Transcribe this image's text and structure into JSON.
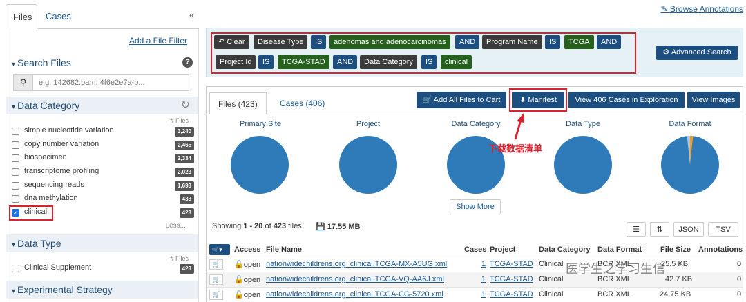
{
  "sidebar": {
    "tabs": [
      {
        "label": "Files"
      },
      {
        "label": "Cases"
      }
    ],
    "collapse_icon": "double-chevron-left-icon",
    "add_filter": "Add a File Filter",
    "search_files": {
      "title": "Search Files",
      "placeholder": "e.g. 142682.bam, 4f6e2e7a-b..."
    },
    "data_category": {
      "title": "Data Category",
      "col_label": "# Files",
      "items": [
        {
          "label": "simple nucleotide variation",
          "count": "3,240",
          "checked": false
        },
        {
          "label": "copy number variation",
          "count": "2,465",
          "checked": false
        },
        {
          "label": "biospecimen",
          "count": "2,334",
          "checked": false
        },
        {
          "label": "transcriptome profiling",
          "count": "2,023",
          "checked": false
        },
        {
          "label": "sequencing reads",
          "count": "1,693",
          "checked": false
        },
        {
          "label": "dna methylation",
          "count": "433",
          "checked": false
        },
        {
          "label": "clinical",
          "count": "423",
          "checked": true
        }
      ],
      "less": "Less..."
    },
    "data_type": {
      "title": "Data Type",
      "col_label": "# Files",
      "items": [
        {
          "label": "Clinical Supplement",
          "count": "423",
          "checked": false
        }
      ]
    },
    "experimental_strategy": {
      "title": "Experimental Strategy"
    }
  },
  "header": {
    "browse_annotations": "Browse Annotations"
  },
  "query": {
    "clear": "Clear",
    "chips_row1": [
      "Disease Type",
      "IS",
      "adenomas and adenocarcinomas",
      "AND",
      "Program Name",
      "IS",
      "TCGA",
      "AND"
    ],
    "chips_row2": [
      "Project Id",
      "IS",
      "TCGA-STAD",
      "AND",
      "Data Category",
      "IS",
      "clinical"
    ],
    "advanced_search": "Advanced Search"
  },
  "main": {
    "tabs": [
      {
        "label": "Files (423)"
      },
      {
        "label": "Cases (406)"
      }
    ],
    "buttons": {
      "add_all": "Add All Files to Cart",
      "manifest": "Manifest",
      "view_cases": "View 406 Cases in Exploration",
      "view_images": "View Images"
    },
    "pie_titles": [
      "Primary Site",
      "Project",
      "Data Category",
      "Data Type",
      "Data Format"
    ],
    "annotation": "下载数据清单",
    "show_more": "Show More",
    "showing": {
      "prefix": "Showing ",
      "range": "1 - 20",
      "of": " of ",
      "total": "423",
      "suffix": " files"
    },
    "total_size": "17.55 MB",
    "tools": {
      "json": "JSON",
      "tsv": "TSV"
    }
  },
  "table": {
    "headers": [
      "Access",
      "File Name",
      "Cases",
      "Project",
      "Data Category",
      "Data Format",
      "File Size",
      "Annotations"
    ],
    "rows": [
      {
        "access": "open",
        "file_name": "nationwidechildrens.org_clinical.TCGA-MX-A5UG.xml",
        "cases": "1",
        "project": "TCGA-STAD",
        "category": "Clinical",
        "format": "BCR XML",
        "size": "25.5 KB",
        "annotations": "0"
      },
      {
        "access": "open",
        "file_name": "nationwidechildrens.org_clinical.TCGA-VQ-AA6J.xml",
        "cases": "1",
        "project": "TCGA-STAD",
        "category": "Clinical",
        "format": "BCR XML",
        "size": "42.7 KB",
        "annotations": "0"
      },
      {
        "access": "open",
        "file_name": "nationwidechildrens.org_clinical.TCGA-CG-5720.xml",
        "cases": "1",
        "project": "TCGA-STAD",
        "category": "Clinical",
        "format": "BCR XML",
        "size": "24.75 KB",
        "annotations": "0"
      }
    ]
  },
  "watermark": "医学生之学习生信",
  "colors": {
    "primary": "#1c4e7f",
    "chip_dark": "#3b3b3b",
    "chip_green": "#25611d",
    "highlight_red": "#d9232e",
    "pie_blue": "#2f7ab8",
    "query_bg": "#e6f1f5"
  }
}
